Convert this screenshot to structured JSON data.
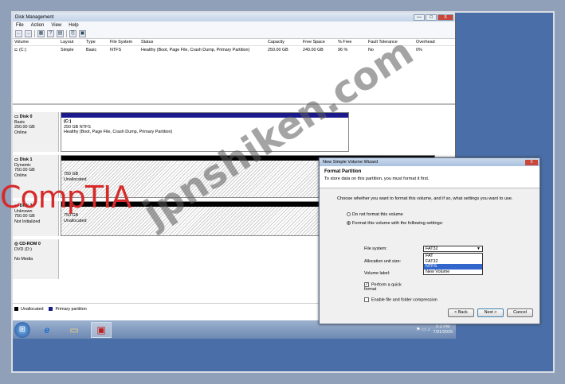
{
  "window": {
    "title": "Disk Management",
    "btn_min": "—",
    "btn_max": "□",
    "btn_close": "X"
  },
  "menu": [
    "File",
    "Action",
    "View",
    "Help"
  ],
  "toolbar": [
    "←",
    "→",
    "▦",
    "?",
    "▤",
    "⎘",
    "▣"
  ],
  "columns": [
    "Volume",
    "Layout",
    "Type",
    "File System",
    "Status",
    "Capacity",
    "Free Space",
    "% Free",
    "Fault Tolerance",
    "Overhead"
  ],
  "volumes": [
    [
      "⊏ (C:)",
      "Simple",
      "Basic",
      "NTFS",
      "Healthy (Boot, Page File, Crash Dump, Primary Partition)",
      "250.00 GB",
      "240.00 GB",
      "96 %",
      "No",
      "0%"
    ]
  ],
  "disks": [
    {
      "name": "Disk 0",
      "type": "Basic",
      "size": "250.00 GB",
      "state": "Online",
      "vol_title": "(C:)",
      "vol_line1": "250 GB NTFS",
      "vol_line2": "Healthy (Boot, Page File, Crash Dump, Primary Partition)",
      "bar": "#1a1a8c"
    },
    {
      "name": "Disk 1",
      "type": "Dynamic",
      "size": "750.00 GB",
      "state": "Online",
      "vol_title": "",
      "vol_line1": "750 GB",
      "vol_line2": "Unallocated",
      "bar": "#000000"
    },
    {
      "name": "Disk 2",
      "type": "Unknown",
      "size": "750.00 GB",
      "state": "Not Initialized",
      "vol_title": "",
      "vol_line1": "750 GB",
      "vol_line2": "Unallocated",
      "bar": "#000000"
    },
    {
      "name": "CD-ROM 0",
      "type": "DVD (D:)",
      "size": "",
      "state": "No Media",
      "vol_title": "",
      "vol_line1": "",
      "vol_line2": "",
      "bar": ""
    }
  ],
  "legend": {
    "unallocated": "Unallocated",
    "primary": "Primary partition"
  },
  "taskbar": {
    "start": "⊞",
    "ie": "e",
    "explorer": "▭",
    "diskmgmt": "▣",
    "tray_icons": "⚑ ▭ ♪",
    "time": "5:3 PM",
    "date": "7/31/2015"
  },
  "wizard": {
    "title": "New Simple Volume Wizard",
    "close": "X",
    "header": "Format Partition",
    "subheader": "To store data on this partition, you must format it first.",
    "prompt": "Choose whether you want to format this volume, and if so, what settings you want to use.",
    "opt_no": "Do not format this volume",
    "opt_yes": "Format this volume with the following settings:",
    "fs_label": "File system:",
    "fs_value": "FAT32",
    "fs_options": [
      "FAT",
      "FAT32",
      "NTFS",
      "New Volume"
    ],
    "alloc_label": "Allocation unit size:",
    "vol_label": "Volume label:",
    "quick": "Perform a quick format",
    "compress": "Enable file and folder compression",
    "btn_back": "< Back",
    "btn_next": "Next >",
    "btn_cancel": "Cancel"
  },
  "watermark": {
    "brand": "CompTIA",
    "site": "jpnshiken.com"
  }
}
